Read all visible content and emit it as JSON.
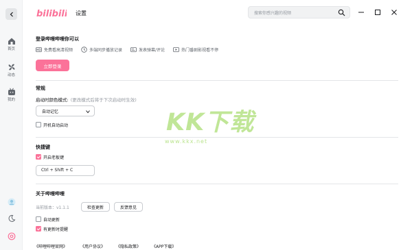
{
  "app": {
    "logo_text": "bilibili",
    "page_title": "设置",
    "search_placeholder": "搜索你感兴趣的视频",
    "colors": {
      "brand": "#fb7299",
      "accent_blue": "#00aeec",
      "text": "#18191c",
      "muted": "#9499a0"
    }
  },
  "sidebar": {
    "items": [
      {
        "label": "首页",
        "icon": "home-icon"
      },
      {
        "label": "动态",
        "icon": "fan-icon"
      },
      {
        "label": "我的",
        "icon": "tv-icon"
      }
    ],
    "bottom_icons": [
      "avatar-icon",
      "moon-icon",
      "settings-icon"
    ]
  },
  "login_section": {
    "title": "登录哔哩哔哩你可以",
    "features": [
      {
        "label": "免费看高清视频",
        "icon": "hd-icon"
      },
      {
        "label": "多端同步播放记录",
        "icon": "clock-icon"
      },
      {
        "label": "发表弹幕/评论",
        "icon": "danmaku-icon"
      },
      {
        "label": "热门番剧影视看不停",
        "icon": "play-icon"
      }
    ],
    "login_button": "立即登录"
  },
  "general": {
    "title": "常规",
    "theme_label": "启动时颜色模式:",
    "theme_hint": "(更改模式后将于下次启动时生效)",
    "theme_value": "自动记忆",
    "autostart_label": "开机自动启动",
    "autostart_checked": false
  },
  "shortcuts": {
    "title": "快捷键",
    "boss_key_label": "开启老板键",
    "boss_key_checked": true,
    "boss_key_value": "Ctrl + Shift + C"
  },
  "about": {
    "title": "关于哔哩哔哩",
    "version": "当前版本：v1.1.1",
    "check_update_button": "检查更新",
    "feedback_button": "反馈意见",
    "auto_update_label": "自动更新",
    "auto_update_checked": false,
    "notify_update_label": "有更新时提醒",
    "notify_update_checked": true,
    "links": [
      "《哔哩哔哩官网》",
      "《用户协议》",
      "《隐私政策》",
      "《APP下载》"
    ]
  },
  "watermark": {
    "big": "KK下载",
    "small": "www.kkx.net"
  }
}
